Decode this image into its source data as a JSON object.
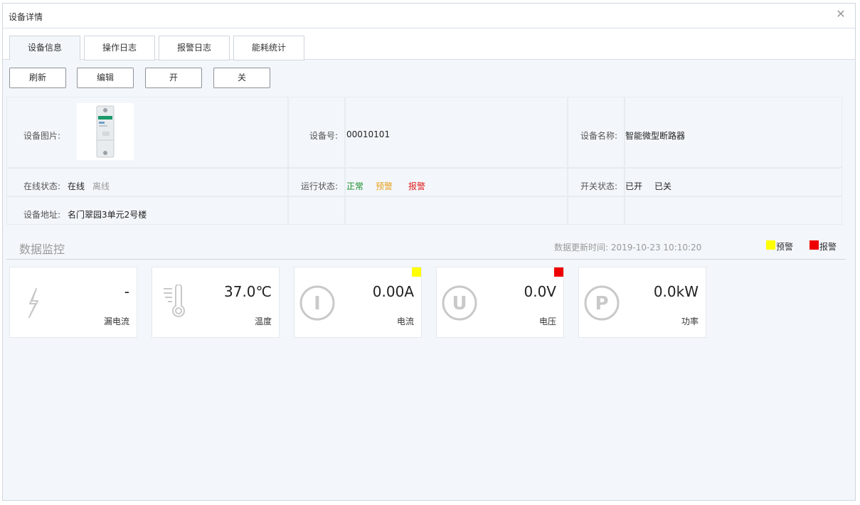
{
  "window": {
    "title": "设备详情",
    "close_symbol": "✕"
  },
  "tabs": [
    {
      "label": "设备信息",
      "active": true
    },
    {
      "label": "操作日志",
      "active": false
    },
    {
      "label": "报警日志",
      "active": false
    },
    {
      "label": "能耗统计",
      "active": false
    }
  ],
  "toolbar": {
    "refresh": "刷新",
    "edit": "编辑",
    "on": "开",
    "off": "关"
  },
  "info": {
    "image_label": "设备图片:",
    "device_no_label": "设备号:",
    "device_no": "00010101",
    "device_name_label": "设备名称:",
    "device_name": "智能微型断路器",
    "online_label": "在线状态:",
    "online": "在线",
    "offline": "离线",
    "run_label": "运行状态:",
    "run_normal": "正常",
    "run_warning": "预警",
    "run_alarm": "报警",
    "switch_label": "开关状态:",
    "switch_on": "已开",
    "switch_off": "已关",
    "address_label": "设备地址:",
    "address": "名门翠园3单元2号楼"
  },
  "monitor": {
    "title": "数据监控",
    "update_time": "数据更新时间: 2019-10-23 10:10:20",
    "legend": [
      {
        "label": "预警",
        "color": "#ffff00"
      },
      {
        "label": "报警",
        "color": "#ee0000"
      }
    ],
    "cards": [
      {
        "name": "漏电流",
        "value": "-",
        "icon": "lightning-icon",
        "flag": null
      },
      {
        "name": "温度",
        "value": "37.0℃",
        "icon": "thermometer-icon",
        "flag": null
      },
      {
        "name": "电流",
        "value": "0.00A",
        "icon": "current-i-icon",
        "flag": "#ffff00"
      },
      {
        "name": "电压",
        "value": "0.0V",
        "icon": "voltage-u-icon",
        "flag": "#ee0000"
      },
      {
        "name": "功率",
        "value": "0.0kW",
        "icon": "power-p-icon",
        "flag": null
      }
    ]
  },
  "icon_letters": {
    "current": "I",
    "voltage": "U",
    "power": "P"
  }
}
